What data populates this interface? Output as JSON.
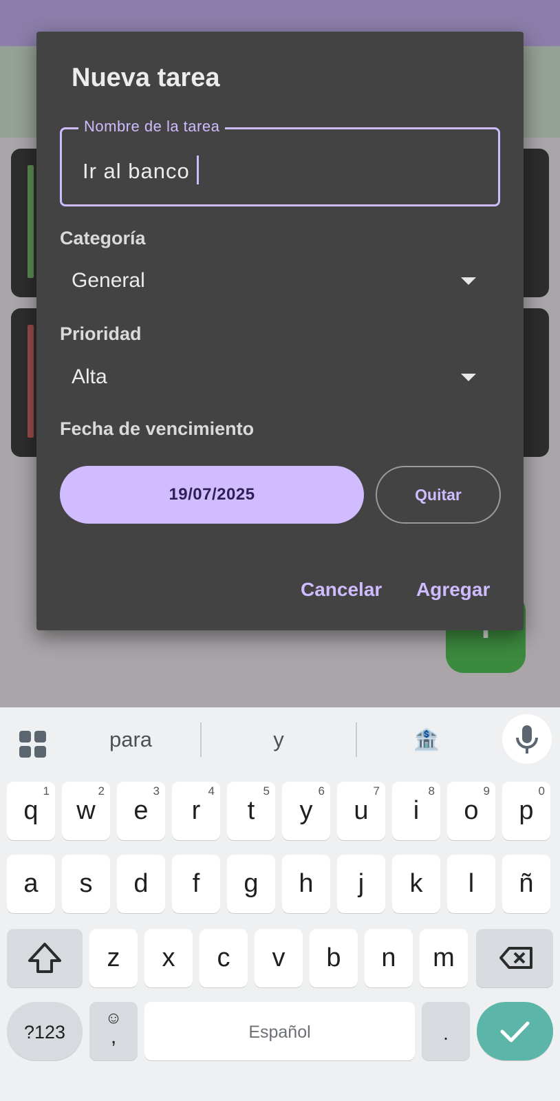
{
  "dialog": {
    "title": "Nueva tarea",
    "name_field": {
      "label": "Nombre de la tarea",
      "value": "Ir al banco"
    },
    "category": {
      "label": "Categoría",
      "value": "General"
    },
    "priority": {
      "label": "Prioridad",
      "value": "Alta"
    },
    "due_date": {
      "label": "Fecha de vencimiento",
      "value": "19/07/2025",
      "remove_label": "Quitar"
    },
    "actions": {
      "cancel": "Cancelar",
      "add": "Agregar"
    }
  },
  "background": {
    "fab_icon": "+"
  },
  "keyboard": {
    "suggestions": [
      "para",
      "y",
      "🏦"
    ],
    "row1": [
      {
        "key": "q",
        "hint": "1"
      },
      {
        "key": "w",
        "hint": "2"
      },
      {
        "key": "e",
        "hint": "3"
      },
      {
        "key": "r",
        "hint": "4"
      },
      {
        "key": "t",
        "hint": "5"
      },
      {
        "key": "y",
        "hint": "6"
      },
      {
        "key": "u",
        "hint": "7"
      },
      {
        "key": "i",
        "hint": "8"
      },
      {
        "key": "o",
        "hint": "9"
      },
      {
        "key": "p",
        "hint": "0"
      }
    ],
    "row2": [
      "a",
      "s",
      "d",
      "f",
      "g",
      "h",
      "j",
      "k",
      "l",
      "ñ"
    ],
    "row3": [
      "z",
      "x",
      "c",
      "v",
      "b",
      "n",
      "m"
    ],
    "symbols_label": "?123",
    "emoji_top": "☺",
    "emoji_bottom": ",",
    "space_label": "Español",
    "period": "."
  },
  "colors": {
    "accent": "#cfbcff",
    "date_button": "#d0bcff",
    "dialog_bg": "#434343",
    "enter_key": "#5bb5a8",
    "fab": "#3c8a3e"
  },
  "icons": {
    "grid": "apps-grid-icon",
    "mic": "microphone-icon",
    "shift": "shift-arrow-icon",
    "backspace": "backspace-icon",
    "enter": "checkmark-icon",
    "dropdown": "caret-down-icon"
  }
}
